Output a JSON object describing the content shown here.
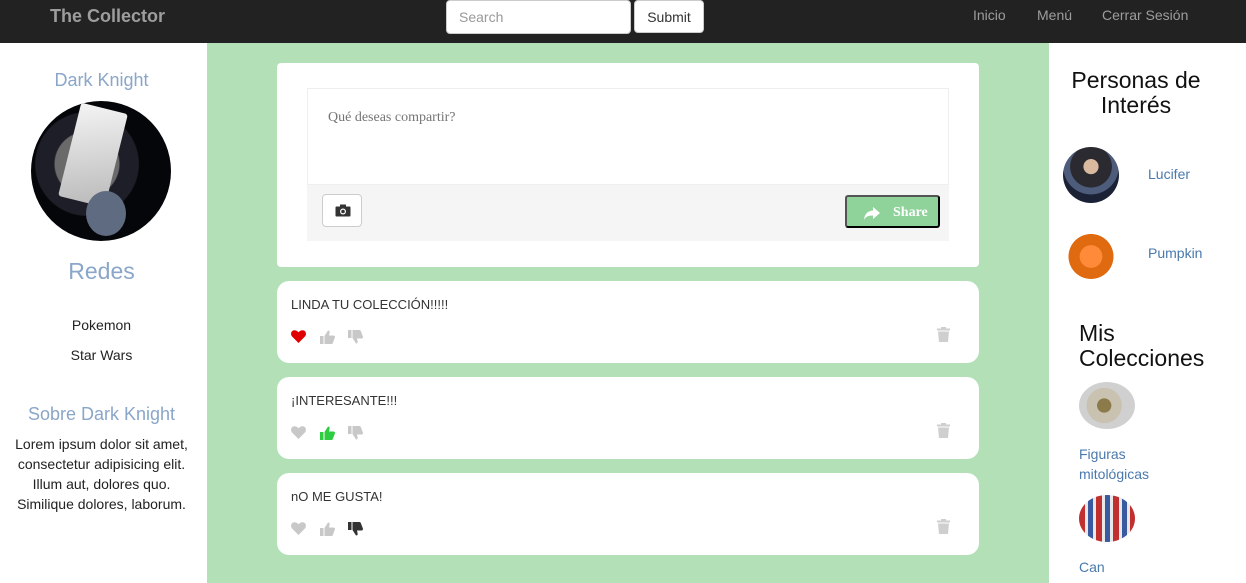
{
  "navbar": {
    "brand": "The Collector",
    "search_placeholder": "Search",
    "submit_label": "Submit",
    "links": [
      "Inicio",
      "Menú",
      "Cerrar Sesión"
    ]
  },
  "profile": {
    "name": "Dark Knight",
    "redes_title": "Redes",
    "redes": [
      "Pokemon",
      "Star Wars"
    ],
    "about_title": "Sobre Dark Knight",
    "about_text": "Lorem ipsum dolor sit amet, consectetur adipisicing elit. Illum aut, dolores quo. Similique dolores, laborum."
  },
  "compose": {
    "placeholder": "Qué deseas compartir?",
    "share_label": "Share"
  },
  "comments": [
    {
      "text": "LINDA TU COLECCIÓN!!!!!",
      "liked": true,
      "thumb_up": false,
      "thumb_down": false
    },
    {
      "text": "¡INTERESANTE!!!",
      "liked": false,
      "thumb_up": true,
      "thumb_down": false
    },
    {
      "text": "nO ME GUSTA!",
      "liked": false,
      "thumb_up": false,
      "thumb_down": true
    }
  ],
  "right": {
    "people_title": "Personas de Interés",
    "people": [
      {
        "name": "Lucifer",
        "avatar": "person-photo"
      },
      {
        "name": "Pumpkin",
        "avatar": "pumpkin-photo"
      }
    ],
    "collections_title": "Mis Colecciones",
    "collections": [
      "Figuras mitológicas",
      "Can"
    ]
  },
  "colors": {
    "navbar_bg": "#222222",
    "center_bg": "#b4e0b8",
    "accent_blue": "#8aa6c8",
    "share_green": "#8fd29a",
    "heart_red": "#e00000",
    "thumb_green": "#2ecc40"
  }
}
